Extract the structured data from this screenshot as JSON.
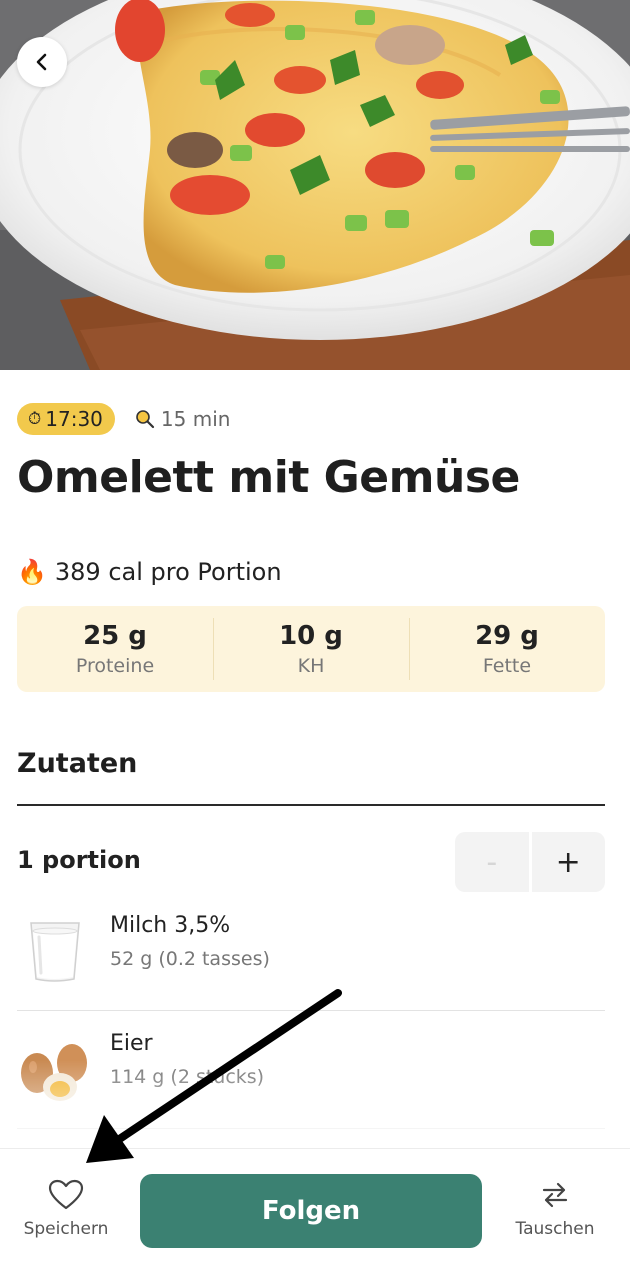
{
  "header": {
    "back_label": ""
  },
  "recipe": {
    "time_badge": "17:30",
    "duration": "15 min",
    "title": "Omelett mit Gemüse",
    "calories": "389 cal pro Portion",
    "macros": [
      {
        "value": "25 g",
        "label": "Proteine"
      },
      {
        "value": "10 g",
        "label": "KH"
      },
      {
        "value": "29 g",
        "label": "Fette"
      }
    ]
  },
  "ingredients_section": {
    "title": "Zutaten",
    "portion_label": "1 portion",
    "stepper": {
      "minus": "-",
      "plus": "+"
    },
    "items": [
      {
        "name": "Milch 3,5%",
        "amount": "52 g (0.2 tasses)",
        "icon": "milk-glass-icon"
      },
      {
        "name": "Eier",
        "amount": "114 g (2 stücks)",
        "icon": "eggs-icon"
      }
    ]
  },
  "bottom_bar": {
    "save_label": "Speichern",
    "follow_label": "Folgen",
    "swap_label": "Tauschen"
  },
  "colors": {
    "accent": "#3b8172",
    "time_badge": "#f2c94c",
    "macro_bg": "#fdf4dc"
  }
}
